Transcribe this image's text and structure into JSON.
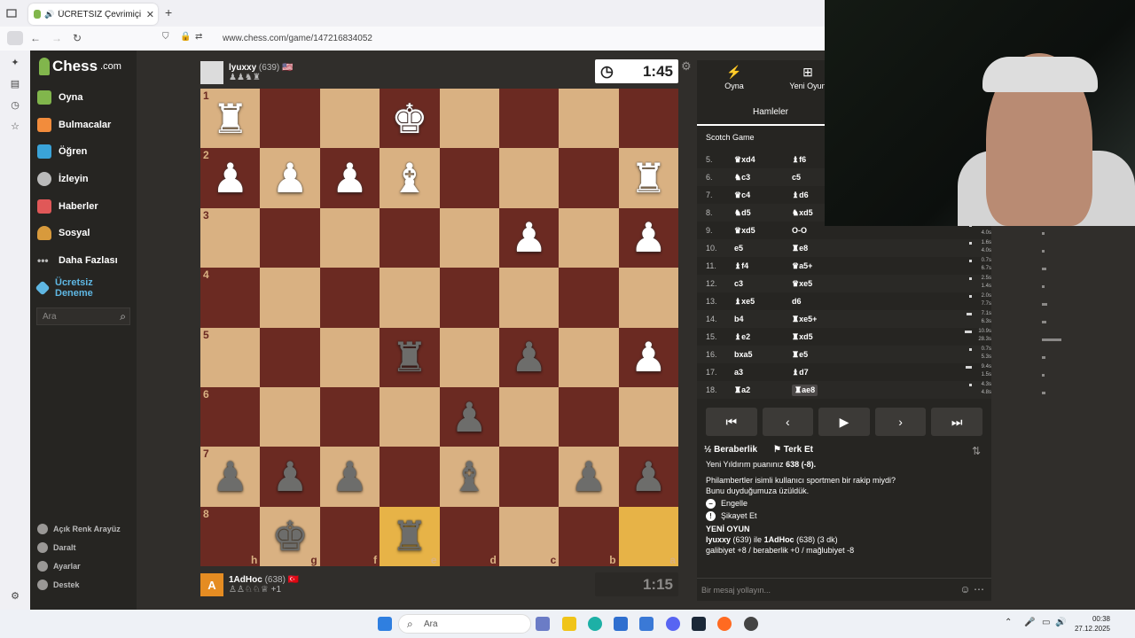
{
  "browser": {
    "tab_title": "ÜCRETSİZ Çevrimiçi Satranç",
    "tab_close": "✕",
    "new_tab": "+",
    "url": "www.chess.com/game/147216834052"
  },
  "sidebar": {
    "logo": "Chess",
    "logo_suffix": ".com",
    "items": [
      {
        "label": "Oyna",
        "color": "#81b64c"
      },
      {
        "label": "Bulmacalar",
        "color": "#f28c3c"
      },
      {
        "label": "Öğren",
        "color": "#3aa3d8"
      },
      {
        "label": "İzleyin",
        "color": "#bababa"
      },
      {
        "label": "Haberler",
        "color": "#e05858"
      },
      {
        "label": "Sosyal",
        "color": "#d89a3c"
      },
      {
        "label": "Daha Fazlası",
        "color": "#bababa"
      }
    ],
    "promo_line1": "Ücretsiz",
    "promo_line2": "Deneme",
    "search_placeholder": "Ara",
    "footer": [
      "Açık Renk Arayüz",
      "Daralt",
      "Ayarlar",
      "Destek"
    ]
  },
  "top_player": {
    "name": "lyuxxy",
    "rating": "(639)",
    "flag": "🇺🇸",
    "captured": "♟♟♞♜",
    "clock": "1:45"
  },
  "bottom_player": {
    "avatar_letter": "A",
    "name": "1AdHoc",
    "rating": "(638)",
    "flag": "🇹🇷",
    "captured": "♙♙♘♘♕",
    "advantage": "+1",
    "clock": "1:15"
  },
  "board": {
    "rank_labels": [
      "1",
      "2",
      "3",
      "4",
      "5",
      "6",
      "7",
      "8"
    ],
    "file_labels": [
      "h",
      "g",
      "f",
      "e",
      "d",
      "c",
      "b",
      "a"
    ],
    "rows": [
      [
        "wR",
        "",
        "",
        "wK",
        "",
        "",
        "",
        ""
      ],
      [
        "wP",
        "wP",
        "wP",
        "wB",
        "",
        "",
        "",
        "wR"
      ],
      [
        "",
        "",
        "",
        "",
        "",
        "wP",
        "",
        "wP"
      ],
      [
        "",
        "",
        "",
        "",
        "",
        "",
        "",
        ""
      ],
      [
        "",
        "",
        "",
        "bR",
        "",
        "bP",
        "",
        "wP"
      ],
      [
        "",
        "",
        "",
        "",
        "bP",
        "",
        "",
        ""
      ],
      [
        "bP",
        "bP",
        "bP",
        "",
        "bB",
        "",
        "bP",
        "bP"
      ],
      [
        "",
        "bK",
        "",
        "bR",
        "",
        "",
        "",
        ""
      ]
    ],
    "highlight": [
      [
        7,
        3
      ],
      [
        7,
        7
      ]
    ]
  },
  "panel": {
    "tab_play": "Oyna",
    "tab_new": "Yeni Oyun",
    "tab_moves": "Hamleler",
    "opening": "Scotch Game",
    "moves": [
      {
        "no": "5.",
        "w": "♛xd4",
        "b": "♝f6",
        "tw": "",
        "tb": ""
      },
      {
        "no": "6.",
        "w": "♞c3",
        "b": "c5",
        "tw": "",
        "tb": ""
      },
      {
        "no": "7.",
        "w": "♛c4",
        "b": "♝d6",
        "tw": "",
        "tb": ""
      },
      {
        "no": "8.",
        "w": "♞d5",
        "b": "♞xd5",
        "tw": "",
        "tb": ""
      },
      {
        "no": "9.",
        "w": "♛xd5",
        "b": "O-O",
        "tw": "1.8s",
        "tb": "4.0s"
      },
      {
        "no": "10.",
        "w": "e5",
        "b": "♜e8",
        "tw": "1.6s",
        "tb": "4.0s"
      },
      {
        "no": "11.",
        "w": "♝f4",
        "b": "♛a5+",
        "tw": "0.7s",
        "tb": "6.7s"
      },
      {
        "no": "12.",
        "w": "c3",
        "b": "♛xe5",
        "tw": "2.5s",
        "tb": "1.4s"
      },
      {
        "no": "13.",
        "w": "♝xe5",
        "b": "d6",
        "tw": "2.0s",
        "tb": "7.7s"
      },
      {
        "no": "14.",
        "w": "b4",
        "b": "♜xe5+",
        "tw": "7.1s",
        "tb": "6.3s"
      },
      {
        "no": "15.",
        "w": "♝e2",
        "b": "♜xd5",
        "tw": "10.9s",
        "tb": "28.3s"
      },
      {
        "no": "16.",
        "w": "bxa5",
        "b": "♜e5",
        "tw": "0.7s",
        "tb": "5.3s"
      },
      {
        "no": "17.",
        "w": "a3",
        "b": "♝d7",
        "tw": "9.4s",
        "tb": "1.5s"
      },
      {
        "no": "18.",
        "w": "♜a2",
        "b": "♜ae8",
        "tw": "4.3s",
        "tb": "4.8s"
      }
    ],
    "draw": "Beraberlik",
    "resign": "Terk Et",
    "chat": {
      "line_rating": "Yeni Yıldırım puanınız ",
      "rating_val": "638 (-8).",
      "sport_q": "Philambertler isimli kullanıcı sportmen bir rakip miydi?",
      "sorry": "Bunu duyduğumuza üzüldük.",
      "block": "Engelle",
      "report": "Şikayet Et",
      "new_game": "YENİ OYUN",
      "pair_a": "lyuxxy",
      "pair_mid": " (639) ile ",
      "pair_b": "1AdHoc",
      "pair_end": " (638) (3 dk)",
      "outcomes": "galibiyet +8 / beraberlik +0 / mağlubiyet -8"
    },
    "msg_placeholder": "Bir mesaj yollayın..."
  },
  "taskbar": {
    "search": "Ara",
    "time": "00:38",
    "date": "27.12.2025"
  }
}
